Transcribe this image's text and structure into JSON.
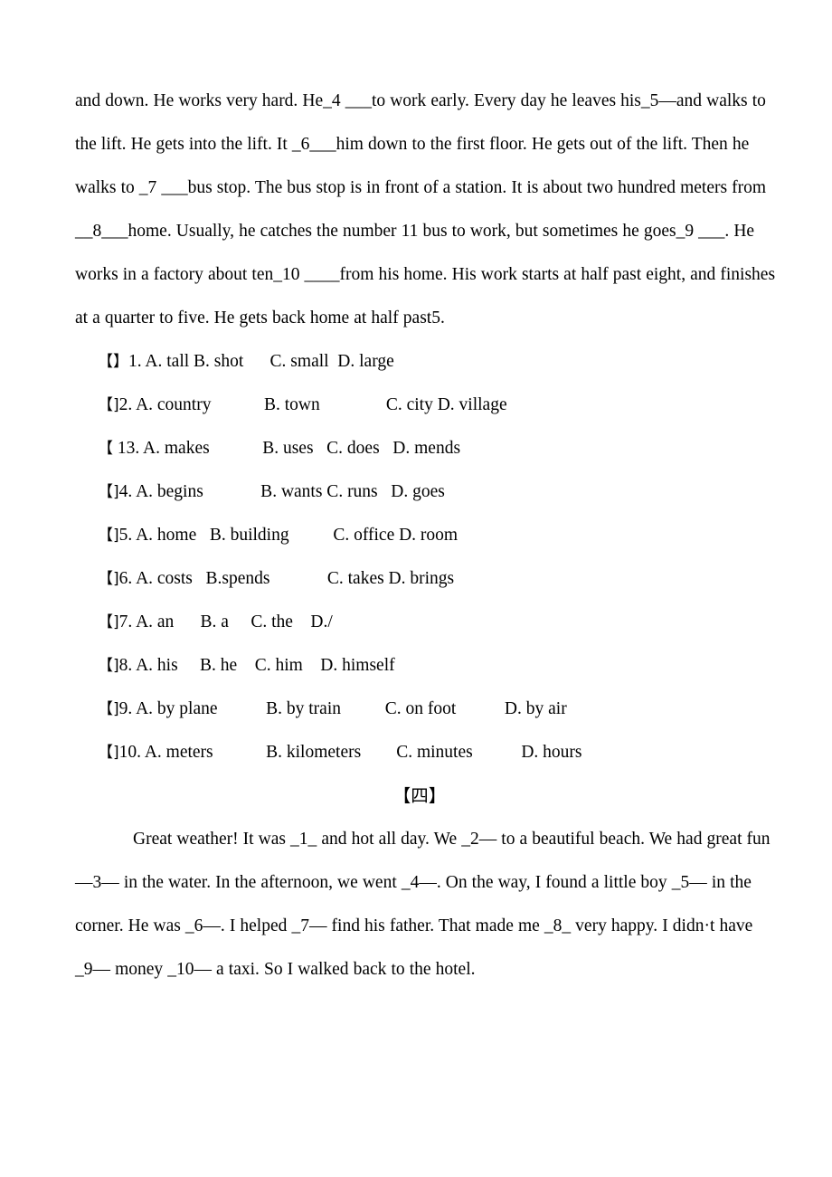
{
  "document": {
    "passage_one": {
      "lines": [
        "and down. He works very hard. He_4  ___to work early. Every day he leaves his_5—and walks to",
        "the lift. He gets into the lift. It _6___him down to the first floor. He gets out of the lift. Then he",
        "walks to _7 ___bus stop. The bus stop is in front of a station. It is about two hundred meters from",
        " __8___home. Usually, he catches the number 11 bus to work, but sometimes he goes_9 ___. He",
        "works in a factory about ten_10 ____from his home. His work starts at half past eight, and finishes",
        "at a quarter to five. He gets back home at half past5."
      ]
    },
    "options": [
      {
        "bracket_left": "【",
        "bracket_right": "】",
        "number": "1.",
        "a": "A. tall",
        "b": "B. shot",
        "c": "C. small",
        "d": "D. large",
        "layout": "1. A. tall B. shot      C. small  D. large"
      },
      {
        "bracket_left": "【",
        "bracket_right": "]",
        "number": "2.",
        "a": "A. country",
        "b": "B. town",
        "c": "C. city",
        "d": "D. village",
        "layout": "2. A. country            B. town               C. city D. village"
      },
      {
        "bracket_left": "【",
        "bracket_right": "",
        "number": "13.",
        "a": "A. makes",
        "b": "B. uses",
        "c": "C. does",
        "d": "D. mends",
        "layout": " 13. A. makes            B. uses   C. does   D. mends"
      },
      {
        "bracket_left": "【",
        "bracket_right": "]",
        "number": "4.",
        "a": "A. begins",
        "b": "B. wants",
        "c": "C. runs",
        "d": "D. goes",
        "layout": "4. A. begins             B. wants C. runs   D. goes"
      },
      {
        "bracket_left": "【",
        "bracket_right": "]",
        "number": "5.",
        "a": "A. home",
        "b": "B. building",
        "c": "C. office",
        "d": "D. room",
        "layout": "5. A. home   B. building          C. office D. room"
      },
      {
        "bracket_left": "【",
        "bracket_right": "]",
        "number": "6.",
        "a": "A. costs",
        "b": "B.spends",
        "c": "C. takes",
        "d": "D. brings",
        "layout": "6. A. costs   B.spends             C. takes D. brings"
      },
      {
        "bracket_left": "【",
        "bracket_right": "]",
        "number": "7.",
        "a": "A. an",
        "b": "B. a",
        "c": "C. the",
        "d": "D./",
        "layout": "7. A. an      B. a     C. the    D./"
      },
      {
        "bracket_left": "【",
        "bracket_right": "]",
        "number": "8.",
        "a": "A. his",
        "b": "B. he",
        "c": "C. him",
        "d": "D. himself",
        "layout": "8. A. his     B. he    C. him    D. himself"
      },
      {
        "bracket_left": "【",
        "bracket_right": "]",
        "number": "9.",
        "a": "A. by plane",
        "b": "B. by train",
        "c": "C. on foot",
        "d": "D. by air",
        "layout": "9. A. by plane           B. by train          C. on foot           D. by air"
      },
      {
        "bracket_left": "【",
        "bracket_right": "]",
        "number": "10.",
        "a": "A. meters",
        "b": "B. kilometers",
        "c": "C. minutes",
        "d": "D. hours",
        "layout": "10. A. meters            B. kilometers        C. minutes           D. hours"
      }
    ],
    "section_heading": "【四】",
    "passage_two": {
      "lines": [
        "Great weather! It was _1_ and hot all day. We _2— to a beautiful beach. We had great fun",
        "—3— in the water. In the afternoon, we went _4—. On the way, I found a little boy _5— in the",
        "corner. He was _6—. I helped _7— find his father. That made me _8_ very happy. I didn·t have",
        "_9— money _10— a taxi. So I walked back to the hotel."
      ]
    }
  }
}
